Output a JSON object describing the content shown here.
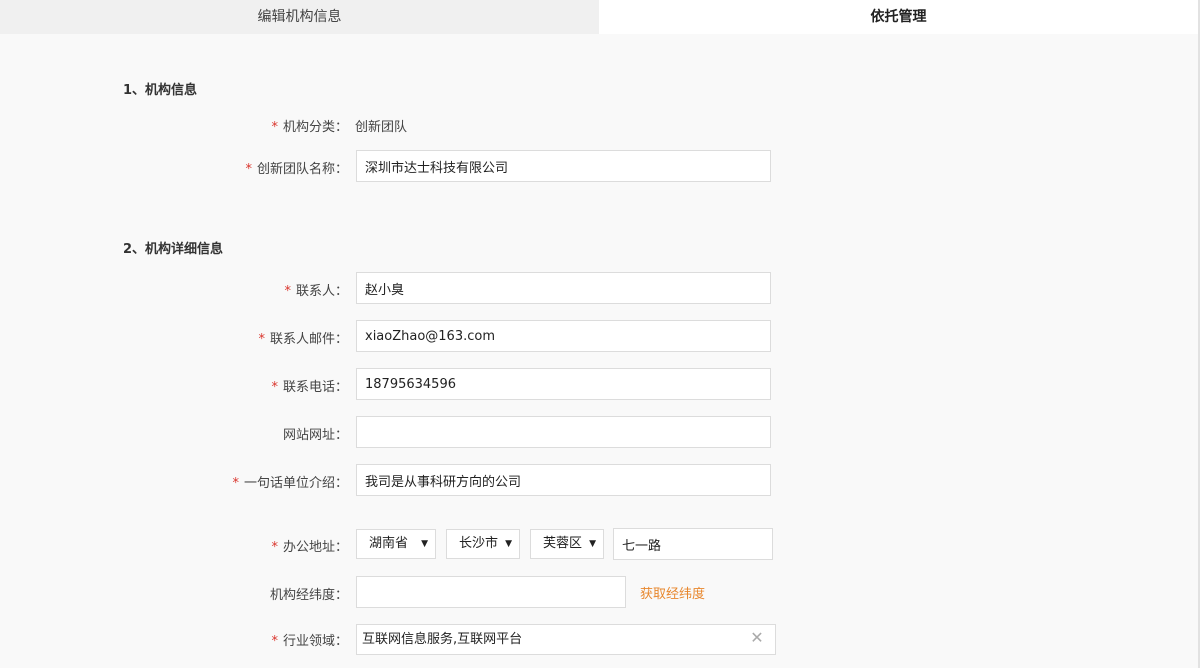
{
  "tabs": [
    {
      "label": "编辑机构信息",
      "active": false
    },
    {
      "label": "依托管理",
      "active": true
    }
  ],
  "sections": {
    "basic": {
      "title": "1、机构信息"
    },
    "detail": {
      "title": "2、机构详细信息"
    }
  },
  "fields": {
    "org_category": {
      "label": "机构分类：",
      "value": "创新团队",
      "required": true
    },
    "team_name": {
      "label": "创新团队名称：",
      "value": "深圳市达士科技有限公司",
      "required": true
    },
    "contact": {
      "label": "联系人：",
      "value": "赵小臭",
      "required": true
    },
    "email": {
      "label": "联系人邮件：",
      "value": "xiaoZhao@163.com",
      "required": true
    },
    "phone": {
      "label": "联系电话：",
      "value": "18795634596",
      "required": true
    },
    "website": {
      "label": "网站网址：",
      "value": "",
      "required": false
    },
    "intro": {
      "label": "一句话单位介绍：",
      "value": "我司是从事科研方向的公司",
      "required": true
    },
    "address": {
      "label": "办公地址：",
      "required": true,
      "province": "湖南省",
      "city": "长沙市",
      "district": "芙蓉区",
      "street": "七一路"
    },
    "coords": {
      "label": "机构经纬度：",
      "value": "",
      "required": false,
      "action": "获取经纬度"
    },
    "industry": {
      "label": "行业领域：",
      "value": "互联网信息服务,互联网平台",
      "required": true
    }
  },
  "required_mark": "*",
  "colors": {
    "required": "#d9332b",
    "link": "#e8872d",
    "background": "#f9f9f9",
    "border": "#dcdcdc"
  },
  "icons": {
    "select_caret": "caret-down-icon",
    "clear": "clear-icon"
  }
}
